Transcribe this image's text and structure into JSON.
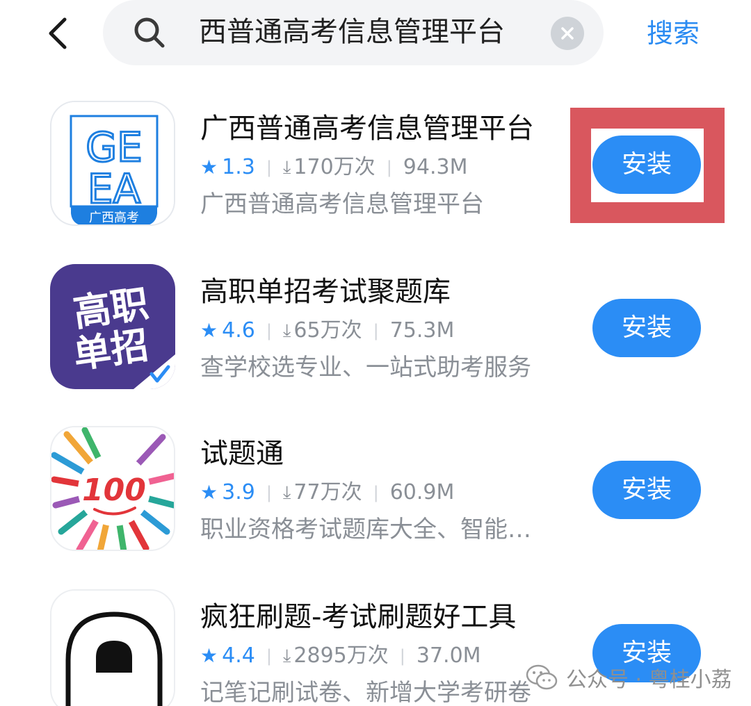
{
  "header": {
    "search_query": "西普通高考信息管理平台",
    "search_button_label": "搜索"
  },
  "apps": [
    {
      "name": "广西普通高考信息管理平台",
      "rating": "1.3",
      "downloads": "170万次",
      "size": "94.3M",
      "description": "广西普通高考信息管理平台",
      "install_label": "安装",
      "icon_text": [
        "GE",
        "EA",
        "广西高考"
      ],
      "icon_colors": {
        "bg": "#ffffff",
        "accent": "#1e7fe0"
      }
    },
    {
      "name": "高职单招考试聚题库",
      "rating": "4.6",
      "downloads": "65万次",
      "size": "75.3M",
      "description": "查学校选专业、一站式助考服务",
      "install_label": "安装",
      "icon_text": [
        "高职",
        "单招"
      ],
      "icon_colors": {
        "bg": "#4a3a8e",
        "accent": "#ffffff"
      }
    },
    {
      "name": "试题通",
      "rating": "3.9",
      "downloads": "77万次",
      "size": "60.9M",
      "description": "职业资格考试题库大全、智能…",
      "install_label": "安装",
      "icon_text": [
        "100"
      ],
      "icon_colors": {
        "bg": "#ffffff",
        "accent": "#e2353a"
      }
    },
    {
      "name": "疯狂刷题-考试刷题好工具",
      "rating": "4.4",
      "downloads": "2895万次",
      "size": "37.0M",
      "description": "记笔记刷试卷、新增大学考研卷",
      "install_label": "安装",
      "icon_text": [],
      "icon_colors": {
        "bg": "#ffffff",
        "accent": "#111111"
      }
    }
  ],
  "watermark": "公众号 · 粤桂小荔",
  "colors": {
    "accent": "#2b8df5",
    "highlight": "#d9575e"
  },
  "icons": [
    "back-arrow-icon",
    "search-icon",
    "clear-icon",
    "star-icon",
    "download-icon",
    "wechat-icon"
  ]
}
